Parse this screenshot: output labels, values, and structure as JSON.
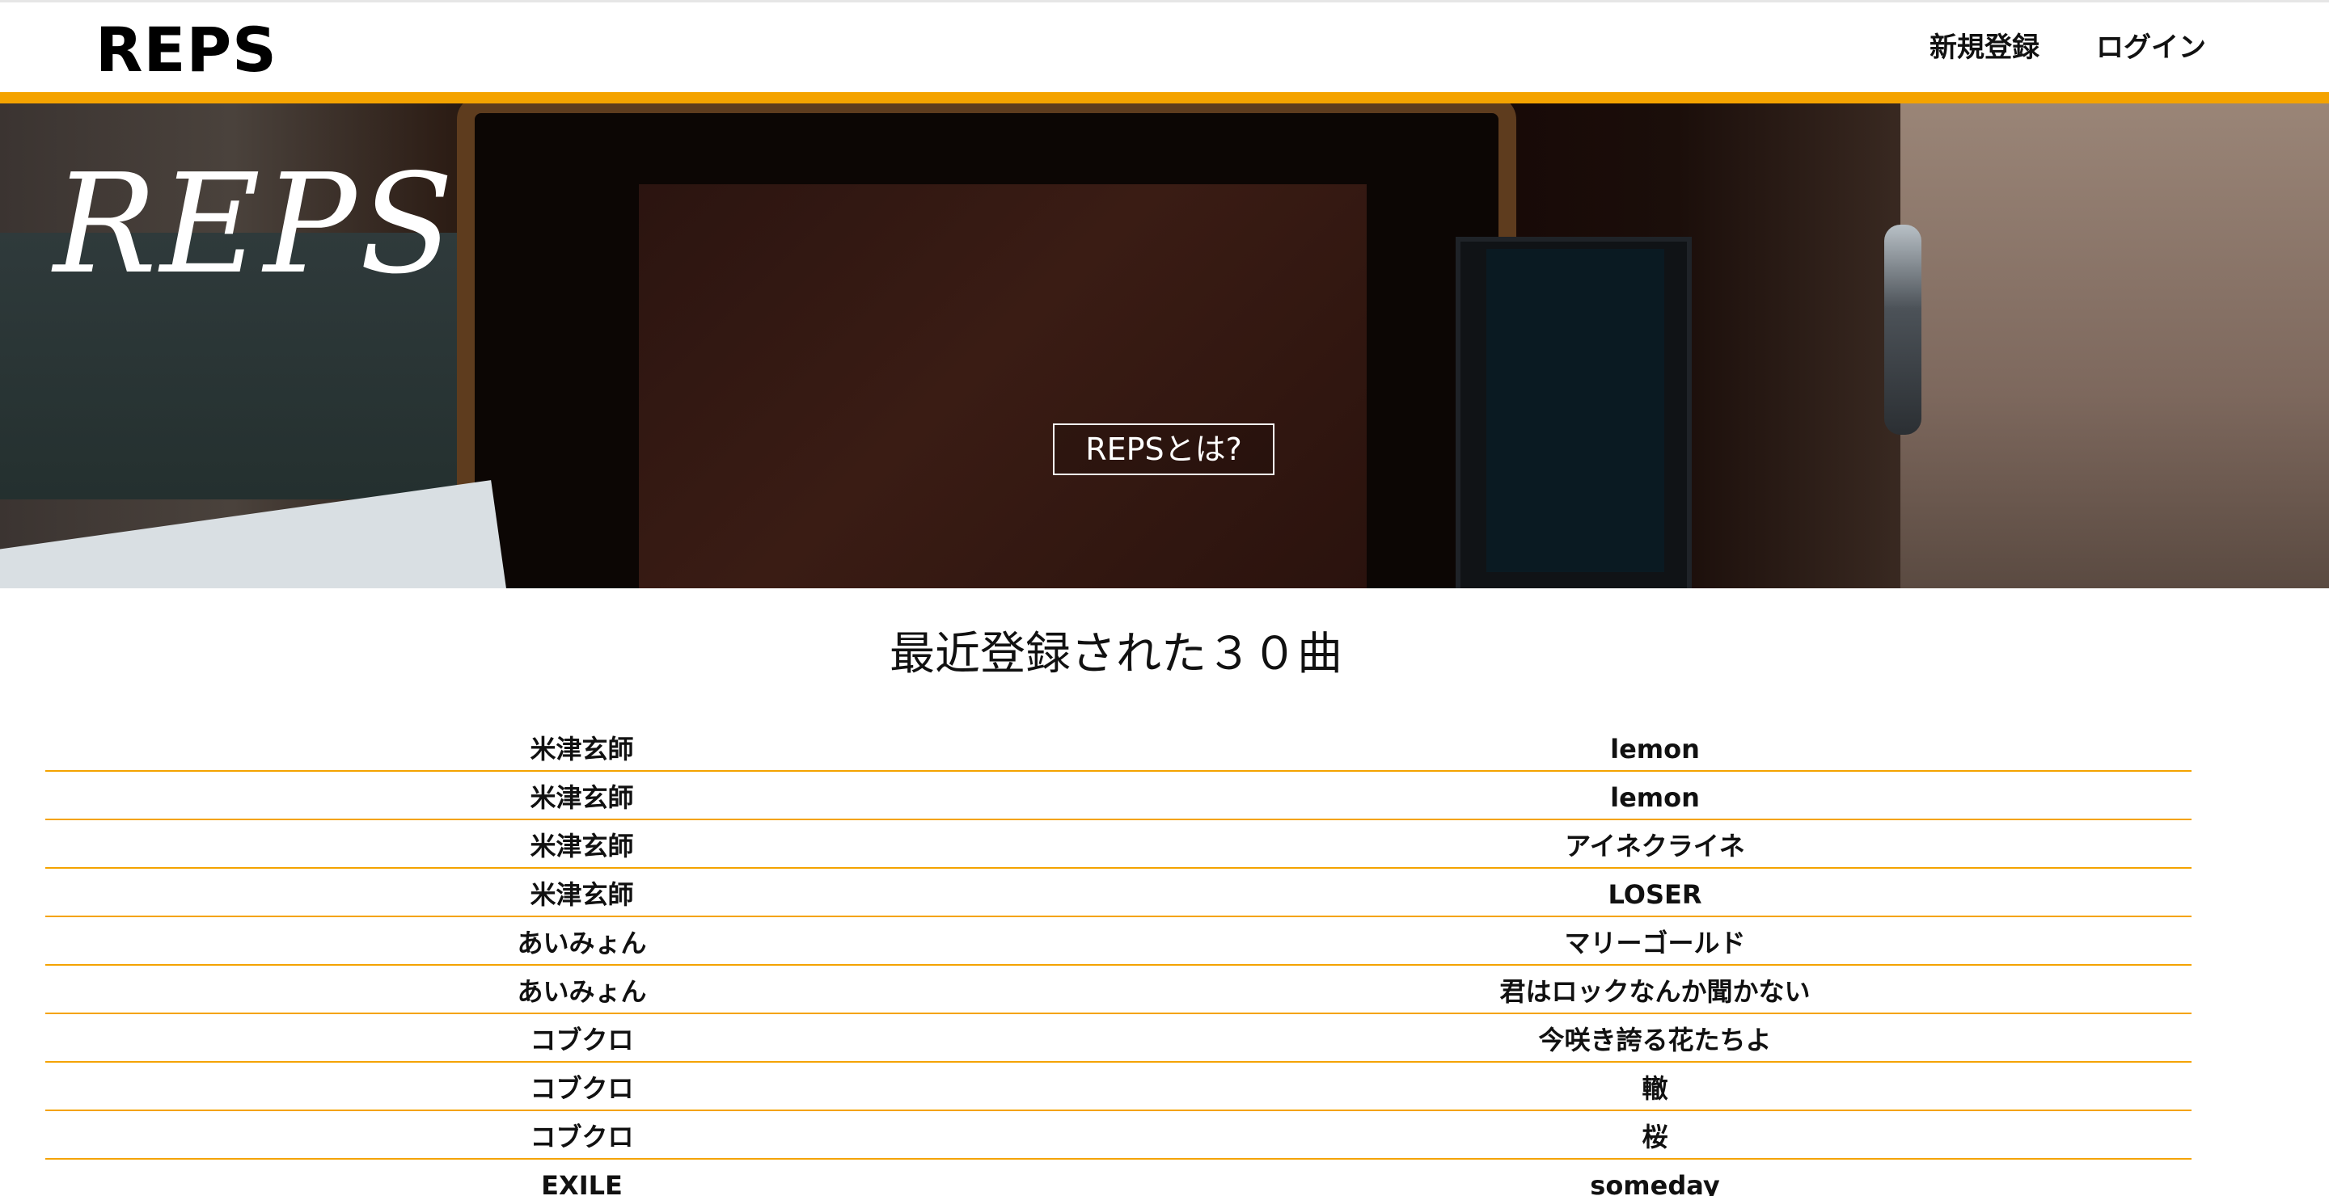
{
  "header": {
    "logo": "REPS",
    "nav": [
      {
        "label": "新規登録"
      },
      {
        "label": "ログイン"
      }
    ],
    "accent_color": "#f4a300"
  },
  "hero": {
    "title": "REPS",
    "button_label": "REPSとは?"
  },
  "recent": {
    "title": "最近登録された３０曲",
    "songs": [
      {
        "artist": "米津玄師",
        "title": "lemon"
      },
      {
        "artist": "米津玄師",
        "title": "lemon"
      },
      {
        "artist": "米津玄師",
        "title": "アイネクライネ"
      },
      {
        "artist": "米津玄師",
        "title": "LOSER"
      },
      {
        "artist": "あいみょん",
        "title": "マリーゴールド"
      },
      {
        "artist": "あいみょん",
        "title": "君はロックなんか聞かない"
      },
      {
        "artist": "コブクロ",
        "title": "今咲き誇る花たちよ"
      },
      {
        "artist": "コブクロ",
        "title": "轍"
      },
      {
        "artist": "コブクロ",
        "title": "桜"
      },
      {
        "artist": "EXILE",
        "title": "someday"
      }
    ]
  }
}
